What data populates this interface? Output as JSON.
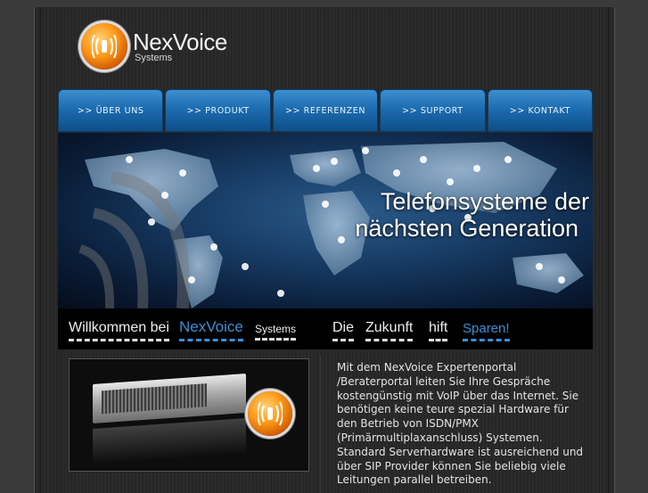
{
  "logo": {
    "name": "NexVoice",
    "sub": "Systems"
  },
  "nav": {
    "items": [
      {
        "label": ">> ÜBER UNS"
      },
      {
        "label": ">> PRODUKT"
      },
      {
        "label": ">> REFERENZEN"
      },
      {
        "label": ">> SUPPORT"
      },
      {
        "label": ">> KONTAKT"
      }
    ]
  },
  "hero": {
    "line1": "Telefonsysteme der",
    "line2": "nächsten Generation"
  },
  "tagline": {
    "welcome": "Willkommen bei",
    "brand": "NexVoice",
    "brand_sub": "Systems",
    "die": "Die",
    "zukunft": "Zukunft",
    "hift": "hift",
    "sparen": "Sparen!"
  },
  "content": {
    "description": "Mit dem NexVoice Expertenportal /Beraterportal leiten Sie Ihre Gespräche kostengünstig mit VoIP über das Internet. Sie benötigen keine teure spezial Hardware für den Betrieb von ISDN/PMX (Primärmultiplaxanschluss) Systemen. Standard Serverhardware ist ausreichend und über SIP Provider können Sie beliebig viele Leitungen parallel betreiben."
  },
  "colors": {
    "accent": "#3b8fd6",
    "nav_blue": "#1c6cb0",
    "logo_orange": "#ff9a1a"
  }
}
